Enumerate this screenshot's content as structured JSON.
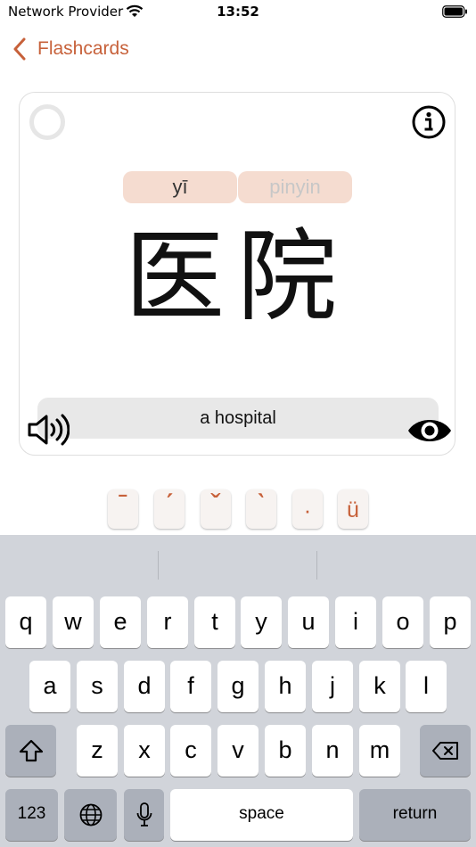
{
  "status_bar": {
    "carrier": "Network Provider",
    "time": "13:52"
  },
  "nav": {
    "back_label": "Flashcards"
  },
  "card": {
    "pinyin_answer": "yī",
    "pinyin_placeholder": "pinyin",
    "hanzi": "医院",
    "meaning": "a hospital"
  },
  "tone_keys": [
    "ˉ",
    "ˊ",
    "ˇ",
    "ˋ",
    "·",
    "ü"
  ],
  "keyboard": {
    "row1": [
      "q",
      "w",
      "e",
      "r",
      "t",
      "y",
      "u",
      "i",
      "o",
      "p"
    ],
    "row2": [
      "a",
      "s",
      "d",
      "f",
      "g",
      "h",
      "j",
      "k",
      "l"
    ],
    "row3": [
      "z",
      "x",
      "c",
      "v",
      "b",
      "n",
      "m"
    ],
    "numbers_label": "123",
    "space_label": "space",
    "return_label": "return"
  },
  "colors": {
    "accent": "#c7613a",
    "pill": "#f5dcd0",
    "keyboard_bg": "#d1d4da"
  },
  "icons": [
    "wifi-icon",
    "battery-icon",
    "chevron-left-icon",
    "progress-ring-icon",
    "info-icon",
    "speaker-icon",
    "eye-icon",
    "shift-icon",
    "backspace-icon",
    "globe-icon",
    "microphone-icon"
  ]
}
